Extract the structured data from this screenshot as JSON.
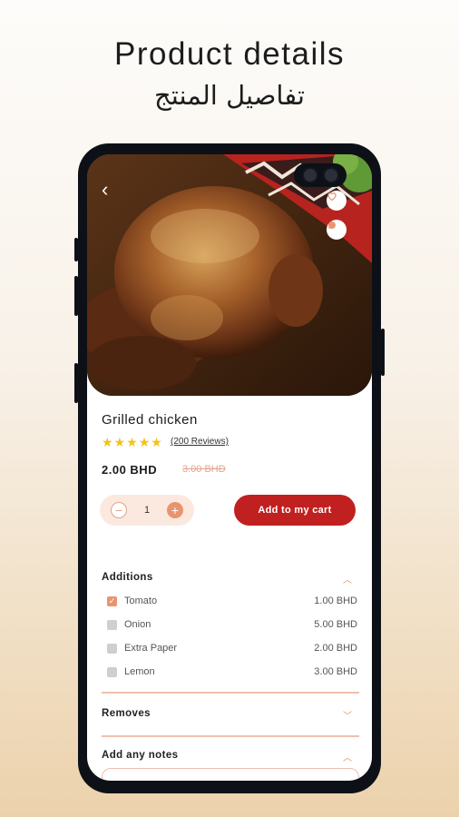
{
  "banner": {
    "title_en": "Product details",
    "title_ar": "تفاصيل المنتج"
  },
  "nav": {
    "back_icon": "chevron-left-icon",
    "favorite_icon": "heart-icon",
    "share_icon": "chat-bubble-icon"
  },
  "product": {
    "name": "Grilled chicken",
    "rating_stars": 5,
    "reviews_label": "(200 Reviews)",
    "price": "2.00 BHD",
    "old_price": "3.00 BHD",
    "quantity": "1",
    "add_to_cart_label": "Add to my cart"
  },
  "additions": {
    "title": "Additions",
    "items": [
      {
        "label": "Tomato",
        "price": "1.00 BHD",
        "checked": true
      },
      {
        "label": "Onion",
        "price": "5.00 BHD",
        "checked": false
      },
      {
        "label": "Extra Paper",
        "price": "2.00 BHD",
        "checked": false
      },
      {
        "label": "Lemon",
        "price": "3.00 BHD",
        "checked": false
      }
    ]
  },
  "removes": {
    "title": "Removes"
  },
  "notes": {
    "title": "Add any notes"
  },
  "colors": {
    "accent": "#c0201f",
    "soft_accent": "#e8956f",
    "star": "#f2c21a"
  }
}
